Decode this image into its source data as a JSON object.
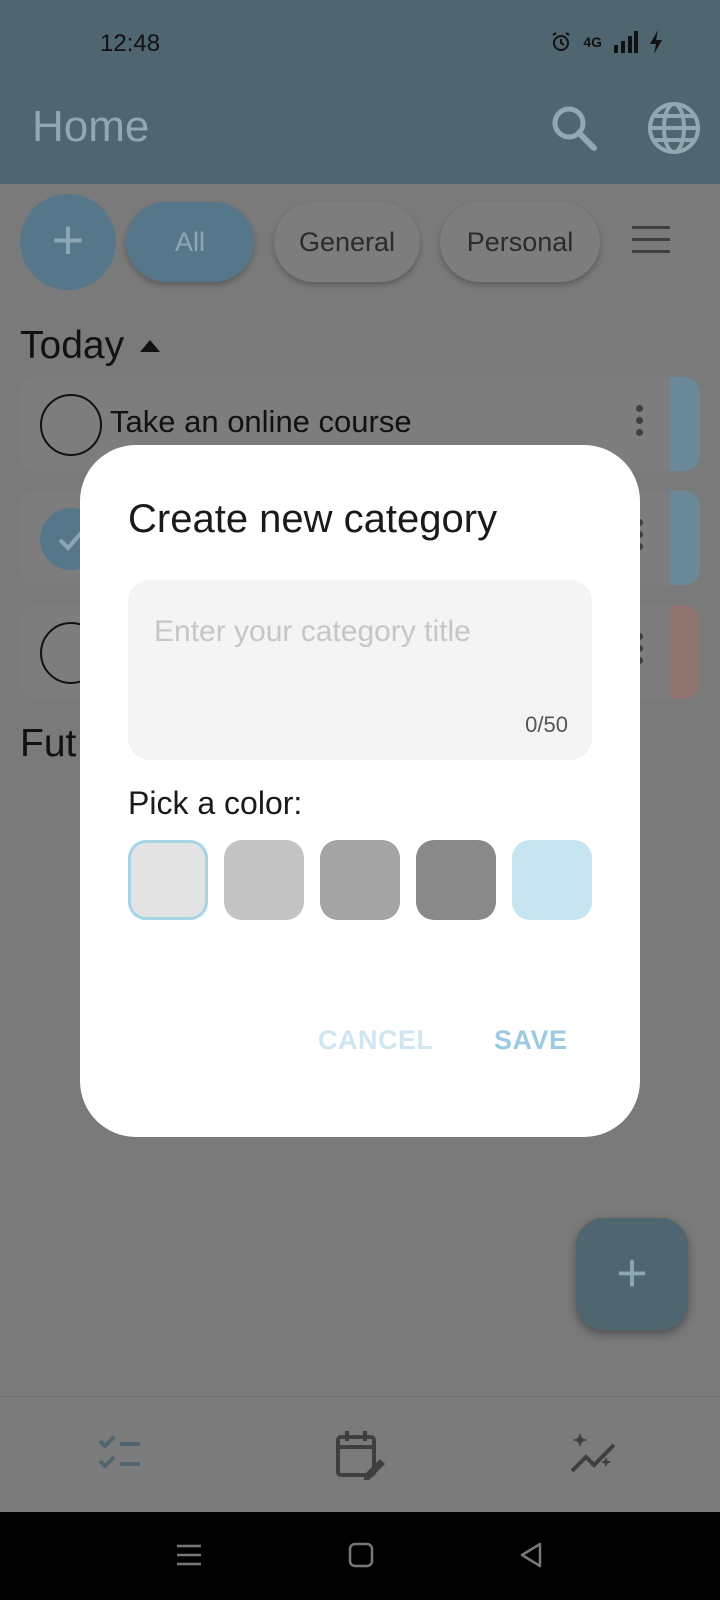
{
  "status_bar": {
    "time": "12:48",
    "network": "4G"
  },
  "app_bar": {
    "title": "Home"
  },
  "filters": {
    "add_symbol": "+",
    "chips": [
      {
        "label": "All",
        "selected": true
      },
      {
        "label": "General",
        "selected": false
      },
      {
        "label": "Personal",
        "selected": false
      }
    ]
  },
  "sections": {
    "today": "Today",
    "future_partial": "Fut"
  },
  "tasks": [
    {
      "title": "Take an online course",
      "done": false,
      "color": "#a9c9d8"
    },
    {
      "title": "",
      "done": true,
      "color": "#a9c9d8"
    },
    {
      "title": "",
      "done": false,
      "color": "#d9a9a3"
    }
  ],
  "fab": {
    "symbol": "+"
  },
  "dialog": {
    "title": "Create new category",
    "input_placeholder": "Enter your category title",
    "input_value": "",
    "counter": "0/50",
    "pick_label": "Pick a color:",
    "colors": [
      "#e3e3e3",
      "#c3c3c3",
      "#a4a4a4",
      "#898989",
      "#c7e4f1"
    ],
    "selected_color_index": 0,
    "cancel_label": "CANCEL",
    "save_label": "SAVE"
  },
  "bottom_nav": {
    "items": [
      {
        "icon": "checklist-icon"
      },
      {
        "icon": "calendar-edit-icon"
      },
      {
        "icon": "sparkle-trend-icon"
      }
    ]
  }
}
